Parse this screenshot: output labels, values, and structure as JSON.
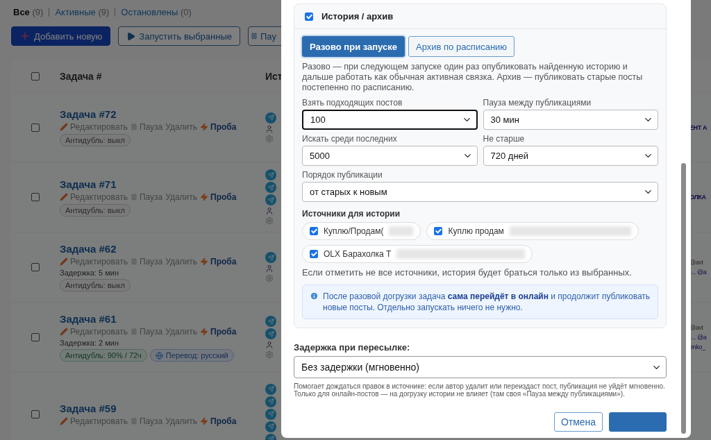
{
  "filter_tabs": [
    {
      "label": "Все",
      "count": "(9)",
      "selected": true
    },
    {
      "label": "Активные",
      "count": "(9)",
      "selected": false
    },
    {
      "label": "Остановлены",
      "count": "(0)",
      "selected": false
    }
  ],
  "toolbar": [
    {
      "kind": "add",
      "label": "Добавить новую"
    },
    {
      "kind": "run",
      "label": "Запустить выбранные"
    },
    {
      "kind": "pause",
      "label": "Пау"
    }
  ],
  "table": {
    "columns": [
      "Задача #",
      "Ист"
    ],
    "header_checked": false,
    "rows": [
      {
        "title": "Задача #72",
        "checked": false,
        "actions": [
          {
            "kind": "edit",
            "label": "Редактировать"
          },
          {
            "kind": "pause",
            "label": "Пауза"
          },
          {
            "kind": "delete",
            "label": "Удалить"
          },
          {
            "kind": "test",
            "label": "Проба"
          }
        ],
        "badges": [
          {
            "kind": "neutral",
            "label": "Антидубль: выкл"
          }
        ],
        "source_icons": [
          {
            "kind": "telegram"
          },
          {
            "kind": "person"
          },
          {
            "kind": "gear"
          }
        ],
        "right_fragments": [
          "ЕНТ А"
        ]
      },
      {
        "title": "Задача #71",
        "checked": false,
        "actions": [
          {
            "kind": "edit",
            "label": "Редактировать"
          },
          {
            "kind": "pause",
            "label": "Пауза"
          },
          {
            "kind": "delete",
            "label": "Удалить"
          },
          {
            "kind": "test",
            "label": "Проба"
          }
        ],
        "badges": [
          {
            "kind": "neutral",
            "label": "Антидубль: выкл"
          }
        ],
        "source_icons": [
          {
            "kind": "telegram"
          },
          {
            "kind": "telegram"
          },
          {
            "kind": "telegram"
          },
          {
            "kind": "person"
          },
          {
            "kind": "gear"
          }
        ],
        "right_fragments": [
          "ОЛКА"
        ]
      },
      {
        "title": "Задача #62",
        "checked": false,
        "actions": [
          {
            "kind": "edit",
            "label": "Редактировать"
          },
          {
            "kind": "pause",
            "label": "Пауза"
          },
          {
            "kind": "delete",
            "label": "Удалить"
          },
          {
            "kind": "test",
            "label": "Проба"
          }
        ],
        "delay": "Задержка: 5 мин",
        "badges": [
          {
            "kind": "neutral",
            "label": "Антидубль: выкл"
          }
        ],
        "source_icons": [
          {
            "kind": "telegram"
          },
          {
            "kind": "person"
          },
          {
            "kind": "gear"
          }
        ],
        "right_fragments": [
          "@avt",
          "-... @a"
        ]
      },
      {
        "title": "Задача #61",
        "checked": false,
        "actions": [
          {
            "kind": "edit",
            "label": "Редактировать"
          },
          {
            "kind": "pause",
            "label": "Пауза"
          },
          {
            "kind": "delete",
            "label": "Удалить"
          },
          {
            "kind": "test",
            "label": "Проба"
          }
        ],
        "delay": "Задержка: 2 мин",
        "badges": [
          {
            "kind": "success",
            "label": "Антидубль: 90% / 72ч"
          },
          {
            "kind": "translate",
            "label": "Перевод: русский"
          }
        ],
        "source_icons": [
          {
            "kind": "telegram"
          },
          {
            "kind": "telegram"
          },
          {
            "kind": "person"
          },
          {
            "kind": "gear"
          }
        ],
        "right_fragments": [
          "@avt",
          "-... @a",
          "enko_"
        ]
      },
      {
        "title": "Задача #59",
        "checked": false,
        "actions": [
          {
            "kind": "edit",
            "label": "Редактировать"
          },
          {
            "kind": "pause",
            "label": "Пауза"
          },
          {
            "kind": "delete",
            "label": "Удалить"
          },
          {
            "kind": "test",
            "label": "Проба"
          }
        ],
        "source_icons": [
          {
            "kind": "telegram"
          },
          {
            "kind": "telegram"
          },
          {
            "kind": "telegram"
          },
          {
            "kind": "telegram"
          },
          {
            "kind": "telegram"
          }
        ]
      }
    ]
  },
  "modal": {
    "section": {
      "title": "История / архив",
      "checked": true,
      "modes": [
        {
          "label": "Разово при запуске",
          "selected": true
        },
        {
          "label": "Архив по расписанию",
          "selected": false
        }
      ],
      "description": "Разово — при следующем запуске один раз опубликовать найденную историю и дальше работать как обычная активная связка. Архив — публиковать старые посты постепенно по расписанию.",
      "fields": [
        {
          "kind": "half",
          "label": "Взять подходящих постов",
          "value": "100",
          "focused": true
        },
        {
          "kind": "half",
          "label": "Пауза между публикациями",
          "value": "30 мин",
          "focused": false
        },
        {
          "kind": "half",
          "label": "Искать среди последних",
          "value": "5000",
          "focused": false
        },
        {
          "kind": "half",
          "label": "Не старше",
          "value": "720 дней",
          "focused": false
        },
        {
          "kind": "full",
          "label": "Порядок публикации",
          "value": "от старых к новым",
          "focused": false
        }
      ],
      "sources_title": "Источники для истории",
      "sources": [
        {
          "label": "Куплю/Продам(",
          "checked": true,
          "redacted": true
        },
        {
          "label": "Куплю продам",
          "checked": true,
          "redacted": true
        },
        {
          "label": "OLX Барахолка Т",
          "checked": true,
          "redacted": true
        }
      ],
      "sources_hint": "Если отметить не все источники, история будет браться только из выбранных.",
      "info": "После разовой догрузки задача **сама перейдёт в онлайн** и продолжит публиковать новые посты. Отдельно запускать ничего не нужно."
    },
    "delay_label": "Задержка при пересылке:",
    "delay_value": "Без задержки (мгновенно)",
    "delay_help": "Помогает дождаться правок в источнике: если автор удалит или переиздаст пост, публикация не уйдёт мгновенно. Только для онлайн-постов — на догрузку истории не влияет (там своя «Пауза между публикациями»).",
    "buttons": [
      {
        "kind": "secondary",
        "label": "Отмена"
      },
      {
        "kind": "primary"
      }
    ]
  }
}
